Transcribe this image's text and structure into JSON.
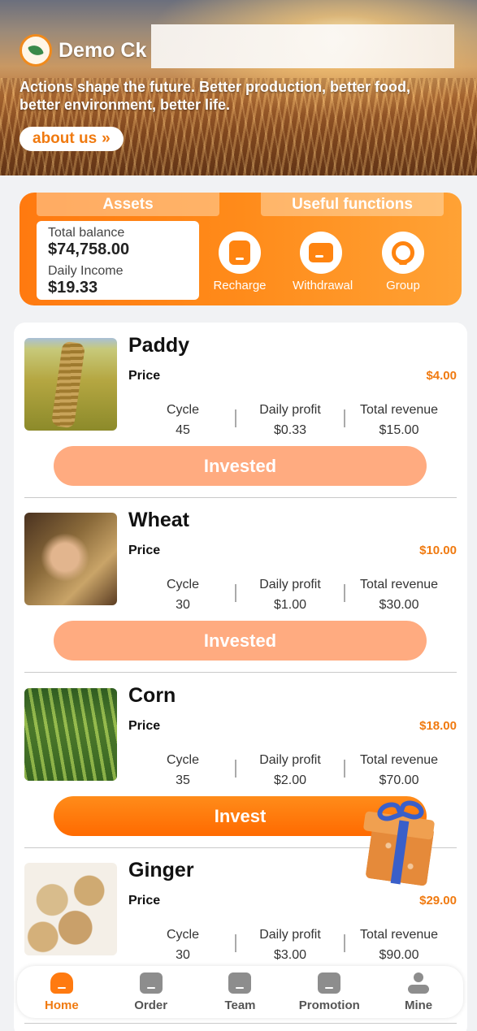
{
  "header": {
    "brand_name": "Demo Ck",
    "tagline": "Actions shape the future. Better production, better food, better environment, better life.",
    "about_label": "about us",
    "about_icon": "double-chevron-right-icon"
  },
  "assets": {
    "tab_assets": "Assets",
    "tab_functions": "Useful functions",
    "total_balance_label": "Total balance",
    "total_balance_value": "$74,758.00",
    "daily_income_label": "Daily Income",
    "daily_income_value": "$19.33",
    "functions": [
      {
        "label": "Recharge",
        "icon": "recharge-icon"
      },
      {
        "label": "Withdrawal",
        "icon": "wallet-icon"
      },
      {
        "label": "Group",
        "icon": "headset-icon"
      }
    ]
  },
  "products": [
    {
      "name": "Paddy",
      "price_label": "Price",
      "price": "$4.00",
      "cycle_label": "Cycle",
      "cycle": "45",
      "daily_label": "Daily profit",
      "daily": "$0.33",
      "total_label": "Total revenue",
      "total": "$15.00",
      "action": "Invested"
    },
    {
      "name": "Wheat",
      "price_label": "Price",
      "price": "$10.00",
      "cycle_label": "Cycle",
      "cycle": "30",
      "daily_label": "Daily profit",
      "daily": "$1.00",
      "total_label": "Total revenue",
      "total": "$30.00",
      "action": "Invested"
    },
    {
      "name": "Corn",
      "price_label": "Price",
      "price": "$18.00",
      "cycle_label": "Cycle",
      "cycle": "35",
      "daily_label": "Daily profit",
      "daily": "$2.00",
      "total_label": "Total revenue",
      "total": "$70.00",
      "action": "Invest"
    },
    {
      "name": "Ginger",
      "price_label": "Price",
      "price": "$29.00",
      "cycle_label": "Cycle",
      "cycle": "30",
      "daily_label": "Daily profit",
      "daily": "$3.00",
      "total_label": "Total revenue",
      "total": "$90.00",
      "action": ""
    }
  ],
  "nav": [
    {
      "label": "Home",
      "icon": "home-icon",
      "active": true
    },
    {
      "label": "Order",
      "icon": "order-icon",
      "active": false
    },
    {
      "label": "Team",
      "icon": "team-icon",
      "active": false
    },
    {
      "label": "Promotion",
      "icon": "promotion-icon",
      "active": false
    },
    {
      "label": "Mine",
      "icon": "user-icon",
      "active": false
    }
  ],
  "colors": {
    "accent": "#ff7a10",
    "invested": "#ffab80",
    "price": "#f07a10"
  }
}
